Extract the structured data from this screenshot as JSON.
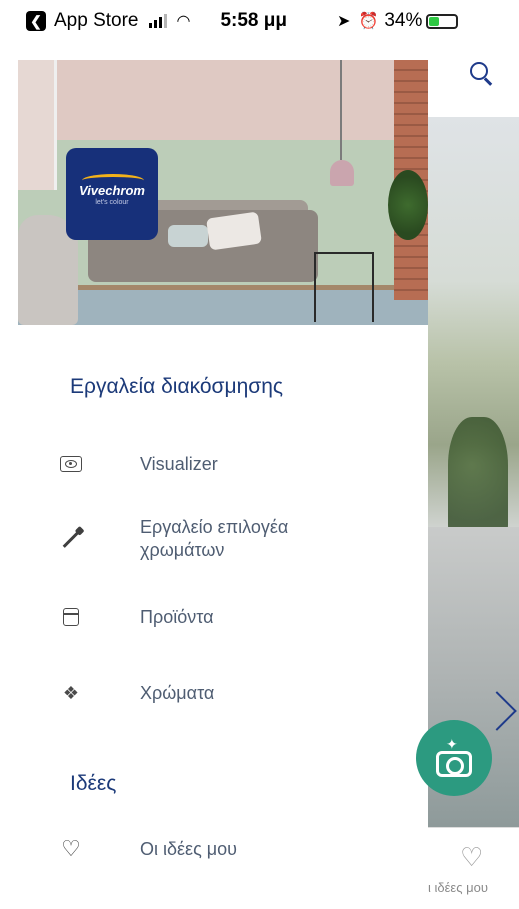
{
  "status_bar": {
    "back_app": "App Store",
    "time": "5:58 μμ",
    "battery": "34%"
  },
  "background_app": {
    "tab_label": "ι ιδέες μου"
  },
  "drawer": {
    "brand": {
      "name": "Vivechrom",
      "tagline": "let's colour"
    },
    "sections": [
      {
        "title": "Εργαλεία διακόσμησης",
        "items": [
          {
            "label": "Visualizer",
            "icon": "visualizer-eye-icon"
          },
          {
            "label": "Εργαλείο επιλογέα χρωμάτων",
            "icon": "color-picker-dropper-icon"
          },
          {
            "label": "Προϊόντα",
            "icon": "paint-can-icon"
          },
          {
            "label": "Χρώματα",
            "icon": "color-swatch-fan-icon"
          }
        ]
      },
      {
        "title": "Ιδέες",
        "items": [
          {
            "label": "Οι ιδέες μου",
            "icon": "heart-icon"
          }
        ]
      }
    ]
  },
  "colors": {
    "accent_navy": "#1c3a79",
    "fab_green": "#2c9a80"
  }
}
